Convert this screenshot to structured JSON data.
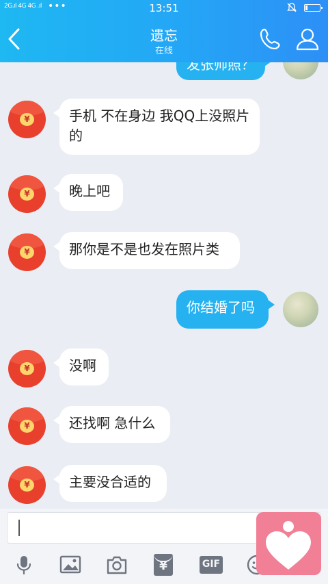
{
  "status_bar": {
    "signal_text": "2G.ıl 4G 4G .ıl",
    "dots": "•••",
    "time": "13:51"
  },
  "header": {
    "title": "遗忘",
    "subtitle": "在线"
  },
  "messages": [
    {
      "side": "right",
      "text": "发张帅照？",
      "partial": true
    },
    {
      "side": "left",
      "text": "手机 不在身边 我QQ上没照片的"
    },
    {
      "side": "left",
      "text": "晚上吧"
    },
    {
      "side": "left",
      "text": "那你是不是也发在照片类"
    },
    {
      "side": "right",
      "text": "你结婚了吗"
    },
    {
      "side": "left",
      "text": "没啊"
    },
    {
      "side": "left",
      "text": "还找啊 急什么"
    },
    {
      "side": "left",
      "text": "主要没合适的"
    }
  ],
  "avatar_symbol": "¥",
  "input": {
    "value": ""
  },
  "toolbar": {
    "gif_label": "GIF",
    "redpacket_symbol": "¥"
  },
  "colors": {
    "header": "#24a6f6",
    "bubble_right": "#26b2f1",
    "redpacket": "#e8402d",
    "floating_badge": "#f17f95"
  }
}
